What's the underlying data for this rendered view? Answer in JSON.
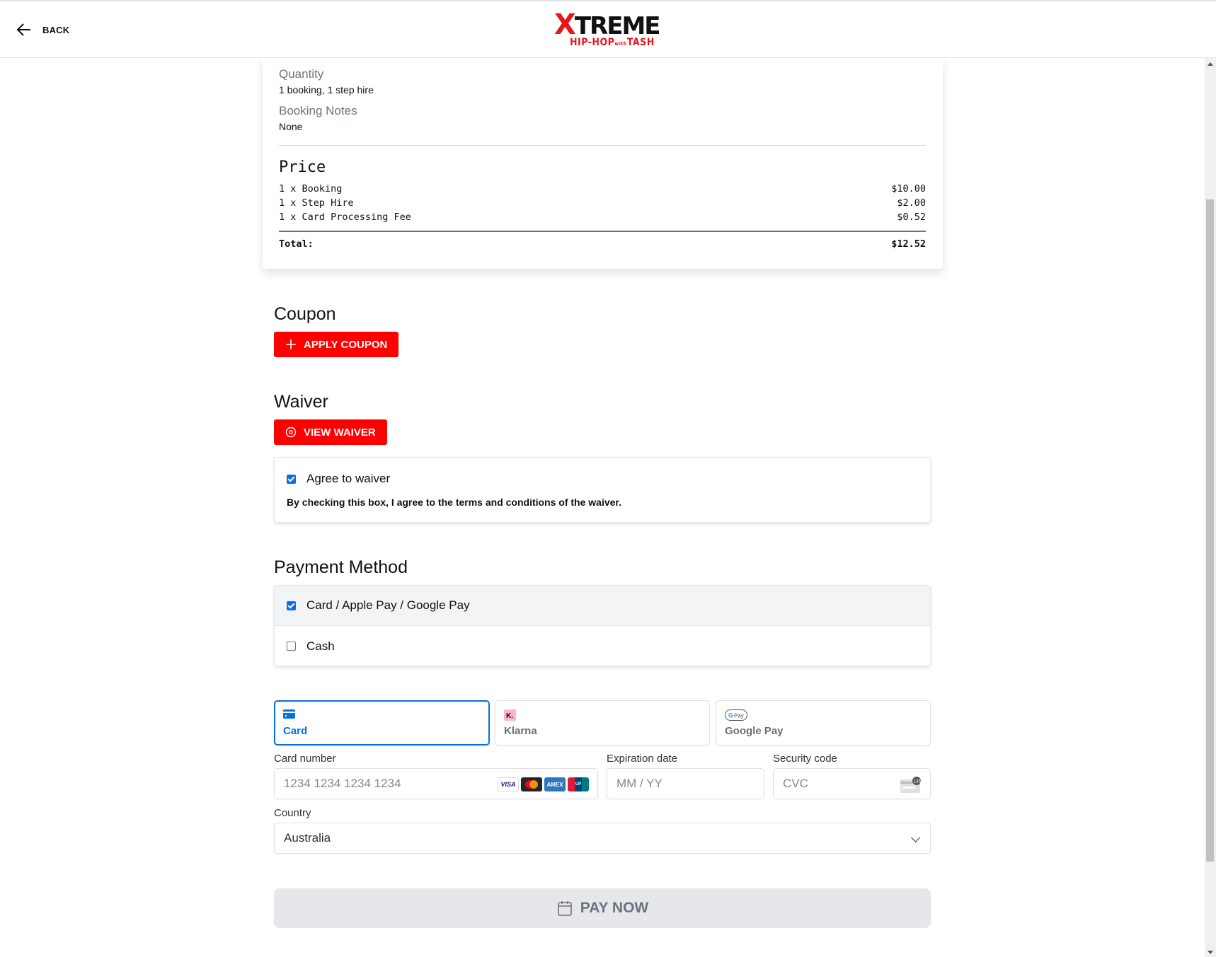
{
  "header": {
    "back_label": "BACK",
    "logo_x": "X",
    "logo_rest": "TREME",
    "logo_sub": "HIP-HOP",
    "logo_with": "with",
    "logo_name": "TASH"
  },
  "summary": {
    "quantity_label": "Quantity",
    "quantity_value": "1 booking, 1 step hire",
    "notes_label": "Booking Notes",
    "notes_value": "None",
    "price_title": "Price",
    "items": [
      {
        "label": "1 x Booking",
        "amount": "$10.00"
      },
      {
        "label": "1 x Step Hire",
        "amount": "$2.00"
      },
      {
        "label": "1 x Card Processing Fee",
        "amount": "$0.52"
      }
    ],
    "total_label": "Total:",
    "total_amount": "$12.52"
  },
  "coupon": {
    "title": "Coupon",
    "button_label": "APPLY COUPON"
  },
  "waiver": {
    "title": "Waiver",
    "button_label": "VIEW WAIVER",
    "checkbox_label": "Agree to waiver",
    "checked": true,
    "note": "By checking this box, I agree to the terms and conditions of the waiver."
  },
  "payment_method": {
    "title": "Payment Method",
    "options": [
      {
        "label": "Card / Apple Pay / Google Pay",
        "checked": true
      },
      {
        "label": "Cash",
        "checked": false
      }
    ]
  },
  "payment_tabs": [
    {
      "label": "Card",
      "active": true
    },
    {
      "label": "Klarna",
      "active": false
    },
    {
      "label": "Google Pay",
      "active": false
    }
  ],
  "form": {
    "card_number_label": "Card number",
    "card_number_placeholder": "1234 1234 1234 1234",
    "expiry_label": "Expiration date",
    "expiry_placeholder": "MM / YY",
    "cvc_label": "Security code",
    "cvc_placeholder": "CVC",
    "country_label": "Country",
    "country_value": "Australia",
    "card_brands": [
      "VISA",
      "Mastercard",
      "AMEX",
      "UnionPay"
    ]
  },
  "pay_button_label": "PAY NOW",
  "colors": {
    "brand_red": "#ff0000",
    "accent_blue": "#0570de",
    "checkbox_blue": "#0b6ee8"
  }
}
